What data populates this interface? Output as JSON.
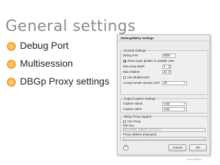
{
  "slide": {
    "title": "General settings",
    "bullets": [
      {
        "label": "Debug Port"
      },
      {
        "label": "Multisession"
      },
      {
        "label": "DBGp Proxy settings"
      }
    ]
  },
  "dialog": {
    "title": "XDebug/DBGp Settings",
    "general": {
      "title": "General Settings",
      "debug_port_label": "Debug Port",
      "debug_port_value": "9000",
      "show_globals_label": "Show super globals in variable view",
      "max_depth_label": "Max array depth",
      "max_depth_value": "3",
      "max_children_label": "Max children",
      "max_children_value": "31",
      "multisession_label": "Use Multisession",
      "remote_session_label": "Accept remote session (JIT)",
      "remote_session_value": "off"
    },
    "output": {
      "title": "Output Capture Settings",
      "stdout_label": "Capture stdout",
      "stdout_value": "copy",
      "stderr_label": "Capture stderr",
      "stderr_value": "copy"
    },
    "proxy": {
      "title": "DBGp Proxy Support",
      "use_proxy_label": "Use Proxy",
      "ide_key_label": "IDE Key",
      "ide_key_value": "ECLIPSE_DBGP_127.0.0.1",
      "proxy_address_label": "Proxy Address (host:port)"
    },
    "buttons": {
      "help": "?",
      "cancel": "Cancel",
      "ok": "OK"
    }
  },
  "footer": {
    "brand": "zend edition"
  },
  "colors": {
    "title_gray": "#8a8a8a",
    "bullet_orange": "#f0a22a"
  }
}
